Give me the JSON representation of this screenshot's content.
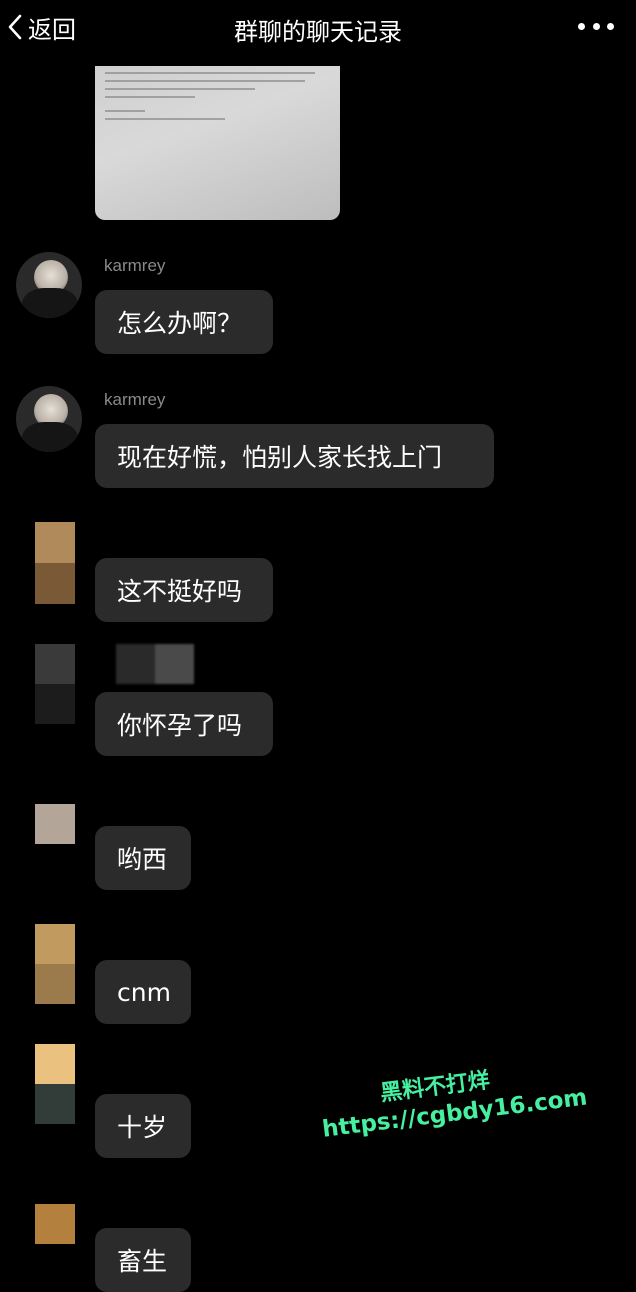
{
  "header": {
    "back_label": "返回",
    "title": "群聊的聊天记录"
  },
  "messages": [
    {
      "sender": "karmrey",
      "text": "怎么办啊？"
    },
    {
      "sender": "karmrey",
      "text": "现在好慌，怕别人家长找上门"
    },
    {
      "sender": "",
      "text": "这不挺好吗"
    },
    {
      "sender": "",
      "text": "你怀孕了吗"
    },
    {
      "sender": "",
      "text": "哟西"
    },
    {
      "sender": "",
      "text": "cnm"
    },
    {
      "sender": "",
      "text": "十岁"
    },
    {
      "sender": "",
      "text": "畜生"
    }
  ],
  "watermark": {
    "line1": "黑料不打烊",
    "line2": "https://cgbdy16.com",
    "color": "#46f0a0"
  },
  "icons": {
    "back": "chevron-left-icon",
    "more": "more-dots-icon"
  }
}
